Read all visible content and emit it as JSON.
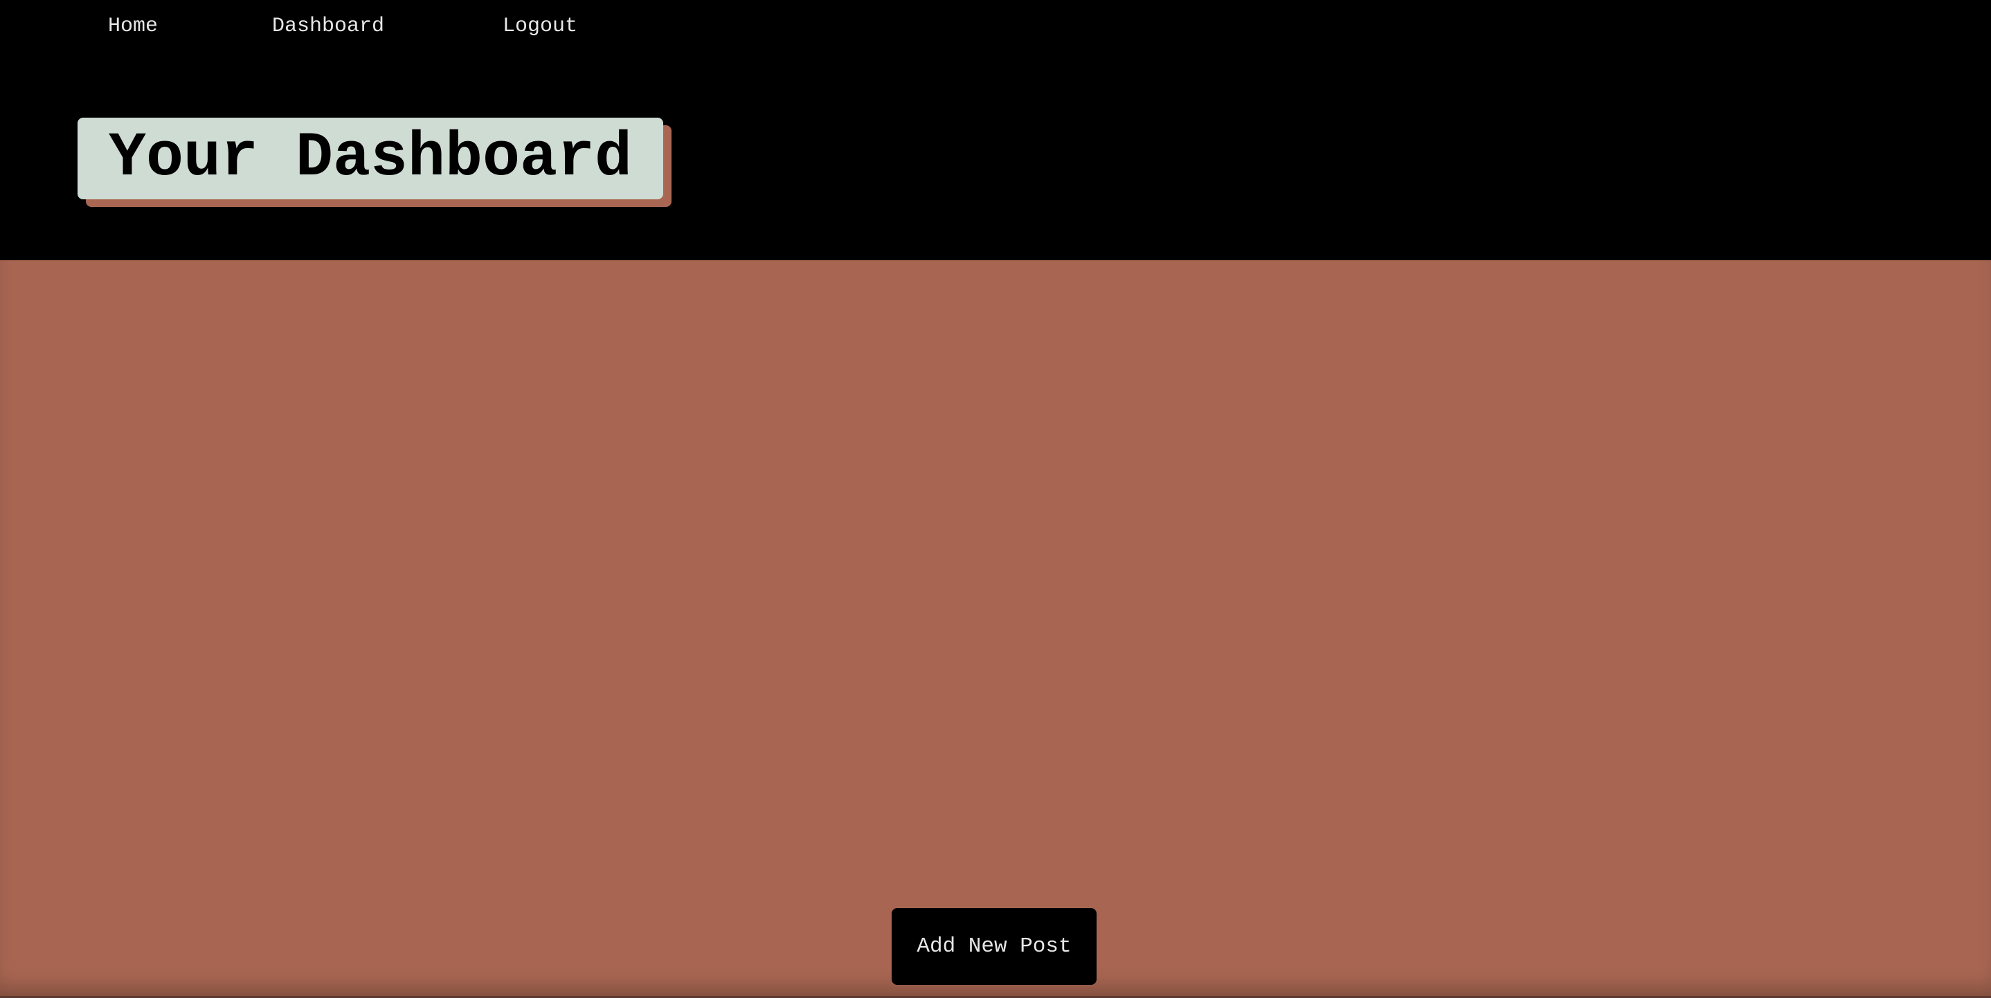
{
  "nav": {
    "items": [
      {
        "label": "Home"
      },
      {
        "label": "Dashboard"
      },
      {
        "label": "Logout"
      }
    ]
  },
  "header": {
    "title": "Your Dashboard"
  },
  "main": {
    "add_post_label": "Add New Post"
  },
  "colors": {
    "header_bg": "#000000",
    "title_box_bg": "#cfdcd3",
    "title_shadow": "#a96652",
    "main_bg": "#a86652",
    "button_bg": "#000000",
    "nav_text": "#e6e6e6"
  }
}
